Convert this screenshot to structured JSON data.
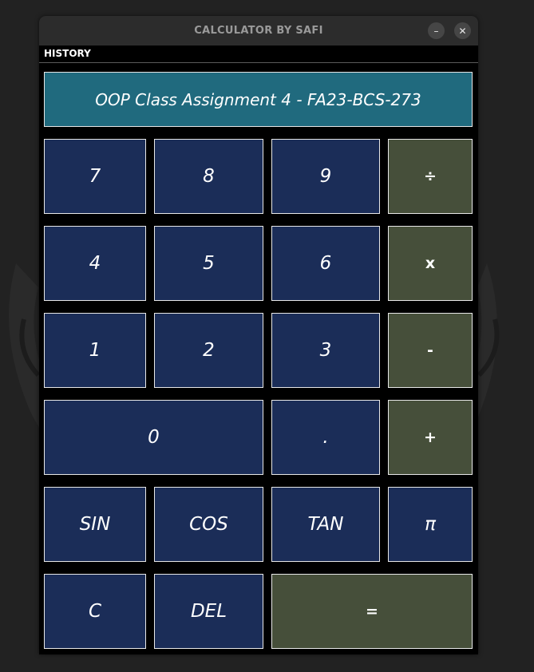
{
  "window": {
    "title": "CALCULATOR BY SAFI",
    "minimize_glyph": "–",
    "close_glyph": "✕"
  },
  "menu": {
    "history": "HISTORY"
  },
  "display": {
    "text": "OOP Class Assignment 4 - FA23-BCS-273"
  },
  "buttons": {
    "seven": "7",
    "eight": "8",
    "nine": "9",
    "divide": "÷",
    "four": "4",
    "five": "5",
    "six": "6",
    "multiply": "x",
    "one": "1",
    "two": "2",
    "three": "3",
    "subtract": "-",
    "zero": "0",
    "dot": ".",
    "add": "+",
    "sin": "SIN",
    "cos": "COS",
    "tan": "TAN",
    "pi": "π",
    "clear": "C",
    "delete": "DEL",
    "equals": "="
  },
  "colors": {
    "digit_button": "#1b2d58",
    "operator_button": "#464f3a",
    "display_background": "#206a7e",
    "window_background": "#000000"
  }
}
